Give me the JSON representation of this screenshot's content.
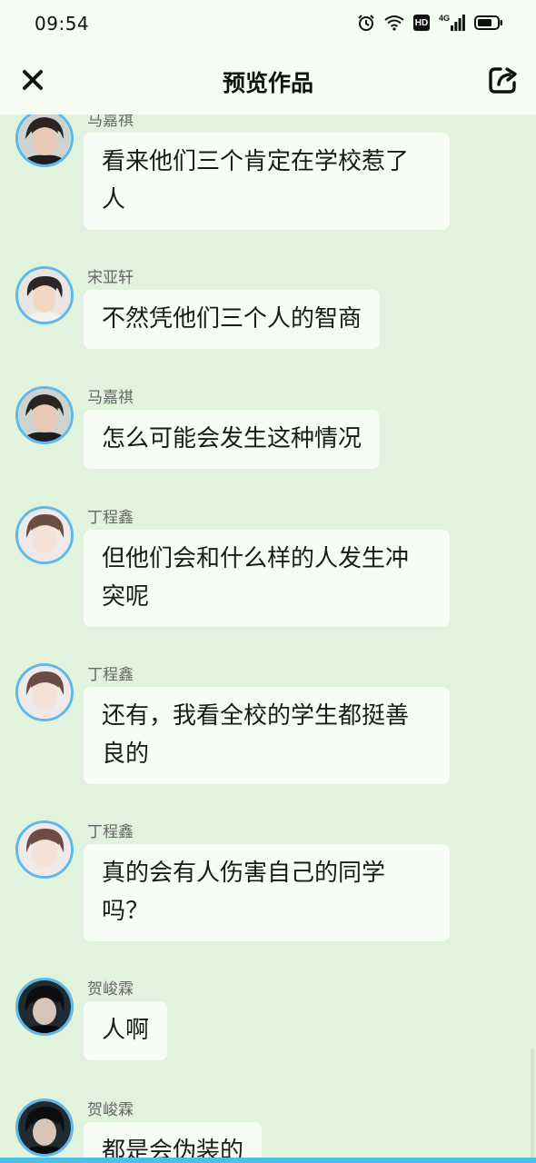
{
  "status_bar": {
    "time": "09:54",
    "network_label": "4G",
    "hd_label": "HD"
  },
  "header": {
    "title": "预览作品",
    "close_icon": "close-icon",
    "share_icon": "share-icon"
  },
  "messages": [
    {
      "sender": "马嘉祺",
      "text": "看来他们三个肯定在学校惹了人",
      "avatar": "avatar-ma"
    },
    {
      "sender": "宋亚轩",
      "text": "不然凭他们三个人的智商",
      "avatar": "avatar-song"
    },
    {
      "sender": "马嘉祺",
      "text": "怎么可能会发生这种情况",
      "avatar": "avatar-ma"
    },
    {
      "sender": "丁程鑫",
      "text": "但他们会和什么样的人发生冲突呢",
      "avatar": "avatar-ding"
    },
    {
      "sender": "丁程鑫",
      "text": "还有，我看全校的学生都挺善良的",
      "avatar": "avatar-ding"
    },
    {
      "sender": "丁程鑫",
      "text": "真的会有人伤害自己的同学吗？",
      "avatar": "avatar-ding"
    },
    {
      "sender": "贺峻霖",
      "text": "人啊",
      "avatar": "avatar-he"
    },
    {
      "sender": "贺峻霖",
      "text": "都是会伪装的",
      "avatar": "avatar-he"
    }
  ],
  "colors": {
    "background": "#e2f3dd",
    "bubble": "#f7fdf6",
    "avatar_ring": "#5fb8ea",
    "bottom_strip": "#4ec0e8"
  }
}
